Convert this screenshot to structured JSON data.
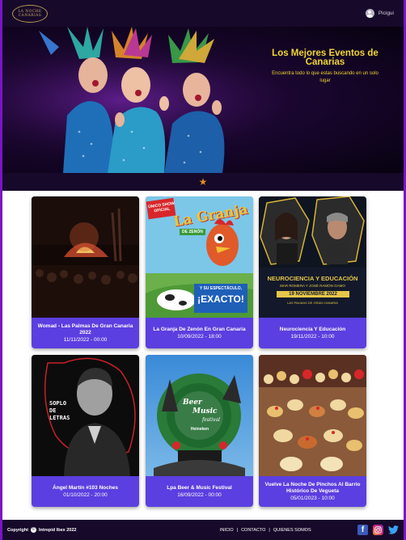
{
  "header": {
    "logo_line1": "LA NOCHE",
    "logo_line2": "CANARIAS",
    "user_name": "Picigui",
    "user_icon": "user-avatar-icon"
  },
  "hero": {
    "title": "Los Mejores Eventos de Canarias",
    "subtitle": "Encuentra todo lo que estas buscando en un solo lugar"
  },
  "carousel": {
    "indicator_icon": "star-icon",
    "color": "#e28d1c"
  },
  "events": [
    {
      "title": "Womad - Las Palmas De Gran Canaria 2022",
      "date": "11/11/2022 - 00:00"
    },
    {
      "title": "La Granja De Zenón En Gran Canaria",
      "date": "10/09/2022 - 18:00"
    },
    {
      "title": "Neurociencia Y Educación",
      "date": "19/11/2022 - 10:00"
    },
    {
      "title": "Ángel Martín #103 Noches",
      "date": "01/10/2022 - 20:00"
    },
    {
      "title": "Lpa Beer & Music Festival",
      "date": "16/09/2022 - 00:00"
    },
    {
      "title": "Vuelve La Noche De Pinchos Al Barrio Histórico De Vegueta",
      "date": "05/01/2023 - 10:00"
    }
  ],
  "posters": {
    "granja": {
      "top": "ÚNICO SHOW OFICIAL",
      "name": "La Granja",
      "sub": "DE ZENÓN",
      "tag": "Y SU ESPECTÁCULO,",
      "big": "¡EXACTO!"
    },
    "neuro": {
      "title": "NEUROCIENCIA Y EDUCACIÓN",
      "names": "MAR ROMERA Y JOSÉ RAMÓN GAMO",
      "date": "19 NOVIEMBRE 2022",
      "place": "LAS PALMAS DE GRAN CANARIA"
    },
    "angel": {
      "text": "SOPLO DE LETRAS"
    },
    "beer": {
      "line1": "Beer",
      "line2": "Music",
      "line3": "festival",
      "brand": "Heineken"
    }
  },
  "footer": {
    "copyright": "Copyright",
    "company": "Intrepid Ibex 2022",
    "links": [
      "INICIO",
      "|",
      "CONTACTO",
      "|",
      "QUIENES SOMOS"
    ],
    "social_icons": [
      "facebook-icon",
      "instagram-icon",
      "twitter-icon"
    ],
    "brand_color": "#5b3fe0"
  }
}
